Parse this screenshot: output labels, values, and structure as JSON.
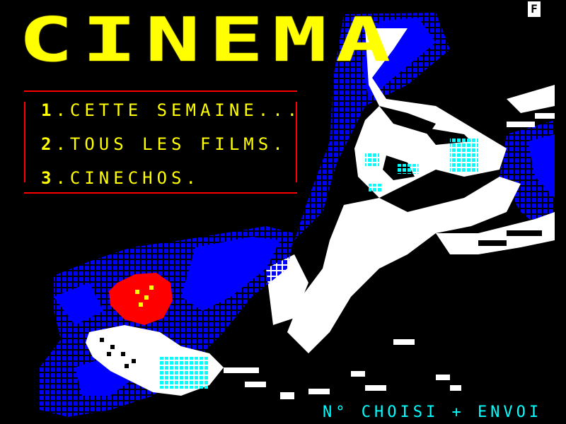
{
  "badge": "F",
  "title": "CINEMA",
  "menu": {
    "items": [
      {
        "number": "1",
        "label": ".CETTE SEMAINE..."
      },
      {
        "number": "2",
        "label": ".TOUS LES FILMS."
      },
      {
        "number": "3",
        "label": ".CINECHOS."
      }
    ]
  },
  "footer": "N° CHOISI + ENVOI",
  "colors": {
    "background": "#000000",
    "title": "#ffff00",
    "menu_border": "#ff0000",
    "footer": "#00ffff",
    "art_blue": "#0000ff",
    "art_white": "#ffffff",
    "art_red": "#ff0000",
    "art_cyan": "#00ffff"
  }
}
